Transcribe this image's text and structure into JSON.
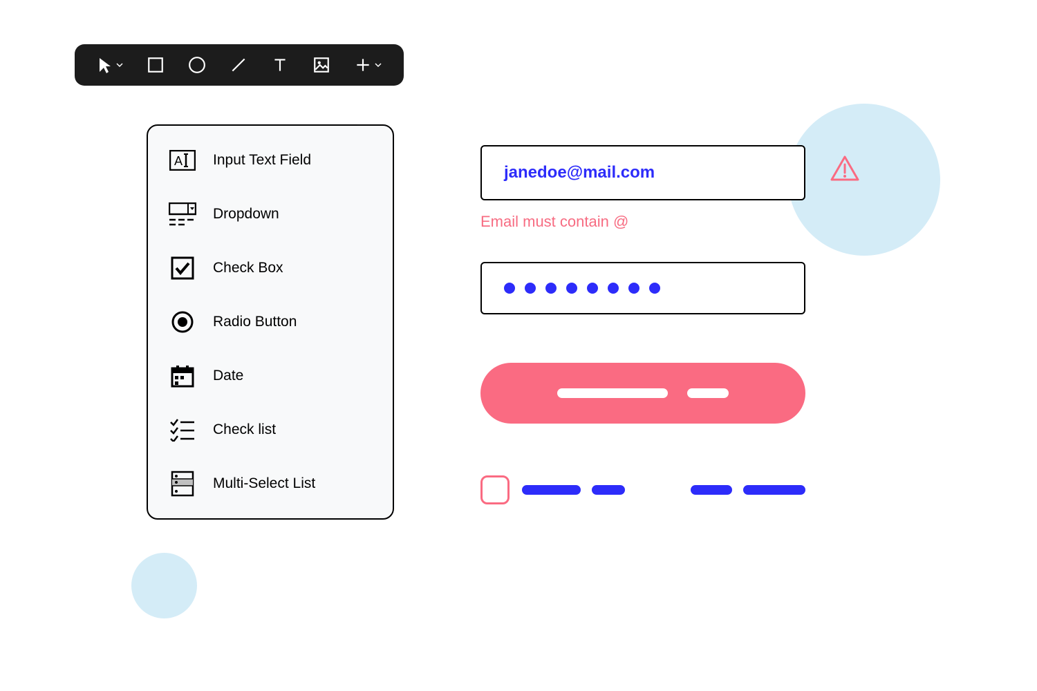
{
  "toolbar": {
    "items": [
      {
        "name": "cursor-tool",
        "has_dropdown": true
      },
      {
        "name": "rectangle-tool",
        "has_dropdown": false
      },
      {
        "name": "circle-tool",
        "has_dropdown": false
      },
      {
        "name": "line-tool",
        "has_dropdown": false
      },
      {
        "name": "text-tool",
        "has_dropdown": false
      },
      {
        "name": "image-tool",
        "has_dropdown": false
      },
      {
        "name": "add-tool",
        "has_dropdown": true
      }
    ]
  },
  "panel": {
    "items": [
      {
        "label": "Input Text Field",
        "icon": "text-input-icon"
      },
      {
        "label": "Dropdown",
        "icon": "dropdown-icon"
      },
      {
        "label": "Check Box",
        "icon": "checkbox-icon"
      },
      {
        "label": "Radio Button",
        "icon": "radio-icon"
      },
      {
        "label": "Date",
        "icon": "calendar-icon"
      },
      {
        "label": "Check list",
        "icon": "checklist-icon"
      },
      {
        "label": "Multi-Select List",
        "icon": "multiselect-icon"
      }
    ]
  },
  "form": {
    "email_value": "janedoe@mail.com",
    "email_error": "Email must contain @",
    "password_dots": 8
  },
  "colors": {
    "accent_blue": "#2d2cfa",
    "accent_pink": "#fa6b82",
    "light_blue": "#d4ecf7"
  }
}
